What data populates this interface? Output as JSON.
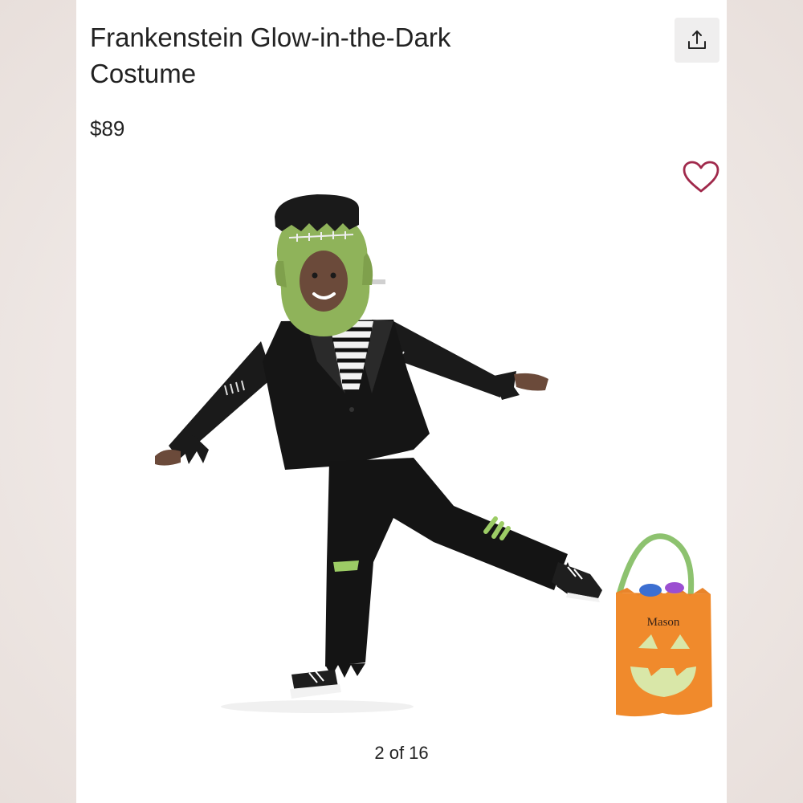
{
  "product": {
    "title_line1": "Frankenstein Glow-in-the-Dark",
    "title_line2": "Costume",
    "price": "$89"
  },
  "image": {
    "bag_name": "Mason"
  },
  "gallery": {
    "indicator": "2 of 16"
  },
  "icons": {
    "share": "share-icon",
    "favorite": "heart-outline-icon"
  },
  "colors": {
    "heart": "#a0294b",
    "text": "#222222",
    "share_bg": "#efeeee"
  }
}
